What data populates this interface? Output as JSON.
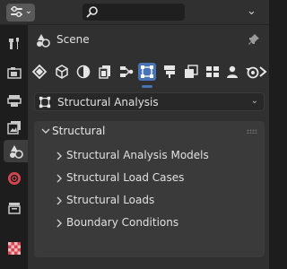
{
  "topbar": {
    "editor_type_icon": "properties-icon",
    "search_placeholder": "",
    "search_icon": "search-icon"
  },
  "context": {
    "icon": "scene-icon",
    "label": "Scene",
    "pin_icon": "pin-icon"
  },
  "tabs": [
    {
      "name": "tool",
      "icon": "tool-icon"
    },
    {
      "name": "render",
      "icon": "render-icon"
    },
    {
      "name": "output",
      "icon": "output-icon"
    },
    {
      "name": "view-layer",
      "icon": "view-layer-icon"
    },
    {
      "name": "scene",
      "icon": "scene-icon",
      "active": true
    },
    {
      "name": "world",
      "icon": "world-icon"
    },
    {
      "name": "collection",
      "icon": "collection-icon"
    },
    {
      "name": "texture",
      "icon": "texture-icon"
    }
  ],
  "addon_icons": [
    "structural-analysis-icon",
    "cube-icon",
    "contrast-icon",
    "documents-icon",
    "network-icon",
    "structural-model-icon",
    "signboard-icon",
    "document-stack-icon",
    "grid-icon",
    "person-icon",
    "blender-icon",
    "chevron-right-icon"
  ],
  "active_addon_index": 5,
  "dropdown": {
    "label": "Structural Analysis",
    "icon": "structural-model-icon"
  },
  "section": {
    "title": "Structural",
    "items": [
      {
        "label": "Structural Analysis Models"
      },
      {
        "label": "Structural Load Cases"
      },
      {
        "label": "Structural Loads"
      },
      {
        "label": "Boundary Conditions"
      }
    ]
  }
}
